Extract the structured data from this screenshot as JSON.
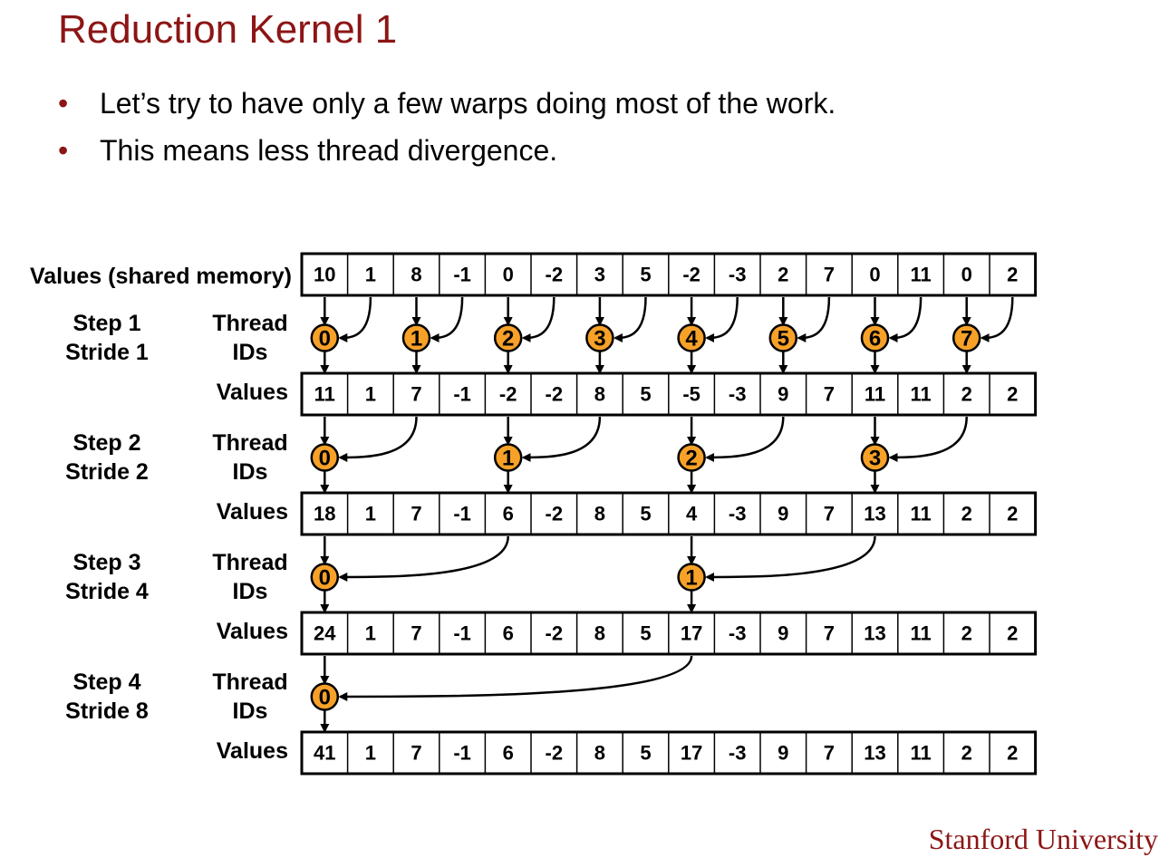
{
  "slide": {
    "title": "Reduction Kernel 1",
    "bullets": [
      "Let’s try to have only a few warps doing most of the work.",
      "This means less thread divergence."
    ],
    "footer": "Stanford University"
  },
  "diagram": {
    "first_row_label": "Values (shared memory)",
    "rows": [
      [
        10,
        1,
        8,
        -1,
        0,
        -2,
        3,
        5,
        -2,
        -3,
        2,
        7,
        0,
        11,
        0,
        2
      ],
      [
        11,
        1,
        7,
        -1,
        -2,
        -2,
        8,
        5,
        -5,
        -3,
        9,
        7,
        11,
        11,
        2,
        2
      ],
      [
        18,
        1,
        7,
        -1,
        6,
        -2,
        8,
        5,
        4,
        -3,
        9,
        7,
        13,
        11,
        2,
        2
      ],
      [
        24,
        1,
        7,
        -1,
        6,
        -2,
        8,
        5,
        17,
        -3,
        9,
        7,
        13,
        11,
        2,
        2
      ],
      [
        41,
        1,
        7,
        -1,
        6,
        -2,
        8,
        5,
        17,
        -3,
        9,
        7,
        13,
        11,
        2,
        2
      ]
    ],
    "steps": [
      {
        "step": "Step 1",
        "stride_label": "Stride 1",
        "stride": 1,
        "thread_label": [
          "Thread",
          "IDs"
        ],
        "threads": [
          0,
          1,
          2,
          3,
          4,
          5,
          6,
          7
        ]
      },
      {
        "step": "Step 2",
        "stride_label": "Stride 2",
        "stride": 2,
        "thread_label": [
          "Thread",
          "IDs"
        ],
        "threads": [
          0,
          1,
          2,
          3
        ]
      },
      {
        "step": "Step 3",
        "stride_label": "Stride 4",
        "stride": 4,
        "thread_label": [
          "Thread",
          "IDs"
        ],
        "threads": [
          0,
          1
        ]
      },
      {
        "step": "Step 4",
        "stride_label": "Stride 8",
        "stride": 8,
        "thread_label": [
          "Thread",
          "IDs"
        ],
        "threads": [
          0
        ]
      }
    ],
    "values_label": "Values",
    "colors": {
      "thread_fill": "#f7a128",
      "thread_stroke": "#000000",
      "title": "#8c1515"
    }
  }
}
